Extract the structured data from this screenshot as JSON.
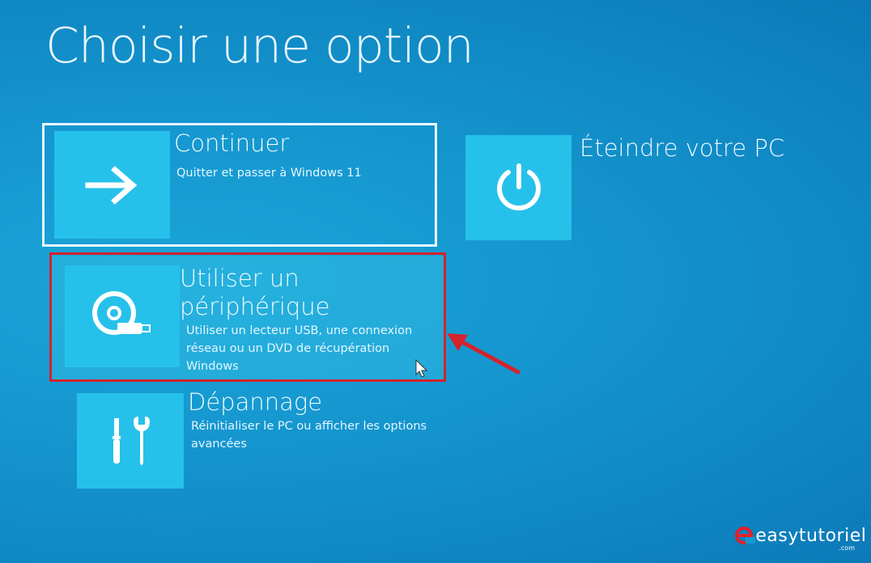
{
  "page_title": "Choisir une option",
  "options": [
    {
      "title": "Continuer",
      "description": "Quitter et passer à Windows 11",
      "icon": "arrow-right-icon"
    },
    {
      "title": "Éteindre votre PC",
      "description": "",
      "icon": "power-icon"
    },
    {
      "title": "Utiliser un périphérique",
      "title_line1": "Utiliser un",
      "title_line2": "périphérique",
      "description_lines": [
        "Utiliser un lecteur USB, une connexion",
        "réseau ou un DVD de récupération",
        "Windows"
      ],
      "icon": "disc-usb-icon"
    },
    {
      "title": "Dépannage",
      "description_lines": [
        "Réinitialiser le PC ou afficher les options",
        "avancées"
      ],
      "icon": "tools-icon"
    }
  ],
  "watermark": {
    "brand": "easytutoriel",
    "suffix": ".com"
  },
  "colors": {
    "background": "#1596cf",
    "tile": "#26c1ea",
    "annotation": "#d4232b"
  }
}
